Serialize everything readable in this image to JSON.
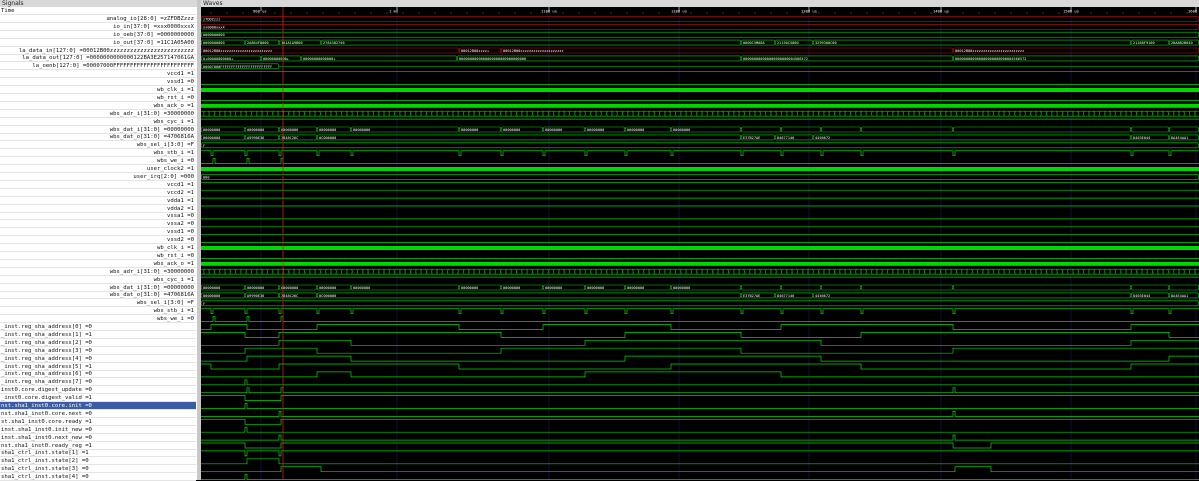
{
  "panes": {
    "signals_title": "Signals",
    "waves_title": "Waves"
  },
  "timeline": {
    "labels": [
      "900 us",
      "1 ms",
      "1100 us",
      "1200 us",
      "1300 us",
      "1400 us",
      "1500 us",
      "1600 us"
    ],
    "cursor_label": "1 ms"
  },
  "signals": [
    {
      "label": "Time",
      "align": "left"
    },
    {
      "label": "analog_io[28:0] =zZFDBZzzz",
      "align": "right"
    },
    {
      "label": "io_in[37:0] =xxx0000xxxX",
      "align": "right"
    },
    {
      "label": "io_oeb[37:0] =0000000000",
      "align": "right"
    },
    {
      "label": "io_out[37:0] =11C1A05A00",
      "align": "right"
    },
    {
      "label": "la_data_in[127:0] =00012B00zzzzzzzzzzzzzzzzzzzzzzzzz",
      "align": "right"
    },
    {
      "label": "la_data_out[127:0] =0000000000000122BA3E257147061GA",
      "align": "right"
    },
    {
      "label": "la_oenb[127:0] =00007000FFFFFFFFFFFFFFFFFFFFFFFF",
      "align": "right"
    },
    {
      "label": "vccd1 =1",
      "align": "right"
    },
    {
      "label": "vssd1 =0",
      "align": "right"
    },
    {
      "label": "wb_clk_i =1",
      "align": "right"
    },
    {
      "label": "wb_rst_i =0",
      "align": "right"
    },
    {
      "label": "wbs_ack_o =1",
      "align": "right"
    },
    {
      "label": "wbs_adr_i[31:0] =30000000",
      "align": "right"
    },
    {
      "label": "wbs_cyc_i =1",
      "align": "right"
    },
    {
      "label": "wbs_dat_i[31:0] =00000000",
      "align": "right"
    },
    {
      "label": "wbs_dat_o[31:0] =4706816A",
      "align": "right"
    },
    {
      "label": "wbs_sel_i[3:0] =F",
      "align": "right"
    },
    {
      "label": "wbs_stb_i =1",
      "align": "right"
    },
    {
      "label": "wbs_we_i =0",
      "align": "right"
    },
    {
      "label": "user_clock2 =1",
      "align": "right"
    },
    {
      "label": "user_irq[2:0] =000",
      "align": "right"
    },
    {
      "label": "vccd1 =1",
      "align": "right"
    },
    {
      "label": "vccd2 =1",
      "align": "right"
    },
    {
      "label": "vdda1 =1",
      "align": "right"
    },
    {
      "label": "vdda2 =1",
      "align": "right"
    },
    {
      "label": "vssa1 =0",
      "align": "right"
    },
    {
      "label": "vssa2 =0",
      "align": "right"
    },
    {
      "label": "vssd1 =0",
      "align": "right"
    },
    {
      "label": "vssd2 =0",
      "align": "right"
    },
    {
      "label": "wb_clk_i =1",
      "align": "right"
    },
    {
      "label": "wb_rst_i =0",
      "align": "right"
    },
    {
      "label": "wbs_ack_o =1",
      "align": "right"
    },
    {
      "label": "wbs_adr_i[31:0] =30000000",
      "align": "right"
    },
    {
      "label": "wbs_cyc_i =1",
      "align": "right"
    },
    {
      "label": "wbs_dat_i[31:0] =00000000",
      "align": "right"
    },
    {
      "label": "wbs_dat_o[31:0] =4706816A",
      "align": "right"
    },
    {
      "label": "wbs_sel_i[3:0] =F",
      "align": "right"
    },
    {
      "label": "wbs_stb_i =1",
      "align": "right"
    },
    {
      "label": "wbs_we_i =0",
      "align": "right"
    },
    {
      "label": "_inst.reg_sha_address[0] =0",
      "align": "left"
    },
    {
      "label": "_inst.reg_sha_address[1] =1",
      "align": "left"
    },
    {
      "label": "_inst.reg_sha_address[2] =0",
      "align": "left"
    },
    {
      "label": "_inst.reg_sha_address[3] =0",
      "align": "left"
    },
    {
      "label": "_inst.reg_sha_address[4] =0",
      "align": "left"
    },
    {
      "label": "_inst.reg_sha_address[5] =1",
      "align": "left"
    },
    {
      "label": "_inst.reg_sha_address[6] =0",
      "align": "left"
    },
    {
      "label": "_inst.reg_sha_address[7] =0",
      "align": "left"
    },
    {
      "label": "inst0.core.digest_update =0",
      "align": "left"
    },
    {
      "label": "_inst0.core.digest_valid =1",
      "align": "left"
    },
    {
      "label": "nst.sha1_inst0.core.init =0",
      "align": "left",
      "selected": true
    },
    {
      "label": "nst.sha1_inst0.core.next =0",
      "align": "left"
    },
    {
      "label": "st.sha1_inst0.core.ready =1",
      "align": "left"
    },
    {
      "label": "inst.sha1_inst0.init_new =0",
      "align": "left"
    },
    {
      "label": "inst.sha1_inst0.next_new =0",
      "align": "left"
    },
    {
      "label": "nst.sha1_inst0.ready_reg =1",
      "align": "left"
    },
    {
      "label": "sha1_ctrl_inst.state[1] =1",
      "align": "left"
    },
    {
      "label": "sha1_ctrl_inst.state[2] =0",
      "align": "left"
    },
    {
      "label": "sha1_ctrl_inst.state[3] =0",
      "align": "left"
    },
    {
      "label": "sha1_ctrl_inst.state[4] =0",
      "align": "left"
    }
  ],
  "bus_values": {
    "analog_io": [
      "z7DDZzzz"
    ],
    "io_in": [
      "xx0000xxxX"
    ],
    "io_oeb": [
      "0000000000"
    ],
    "io_out": [
      "0000000000",
      "2A864F8000",
      "1A1A1A9B00",
      "2784382746",
      "0000C5M00A",
      "21150C5000",
      "3299300C00",
      "21268F9100",
      "2BA8B2B040",
      "11C1A05C40"
    ],
    "la_data_in": [
      "00012B00zzzzzzzzzzzzzzzzzzzzzzzz",
      "00012B00zzzz+",
      "00012B00zzzzzzzzzzzzzzzzzzzz",
      "00012B00zzzzzzzzzzzzzzzzzzzzzzzz"
    ],
    "la_data_out": [
      "0+00000000000+",
      "00000000000+",
      "00000000000000+",
      "0000000000000000000000000000000",
      "000000000000000000000004566572",
      "000000000000000000000000004566572"
    ],
    "la_oenb": [
      "00007000FFFFFFFFFFFFFFFFFFFFFFFF"
    ],
    "wbs_dat_i": [
      "00000000",
      "00000000",
      "00000000",
      "00000000",
      "00000000",
      "00000000",
      "00000000",
      "00000000",
      "00000000",
      "00000000",
      "00000000"
    ],
    "wbs_dat_o": [
      "00000000",
      "A9990E36",
      "7848C26C",
      "0C000000",
      "E37B27AE",
      "84677140",
      "4456672",
      "8403E044",
      "8A4E4AA1",
      "E54B70F1"
    ],
    "wbs_sel_i": [
      "F"
    ],
    "user_irq": [
      "000"
    ]
  },
  "colors": {
    "wave_green": "#00d800",
    "bus_fill_green": "#00b000",
    "cursor_red": "#d02020",
    "selected_row": "#3b5ba5",
    "grid": "#1a1a5a",
    "undefined_red": "#c01010"
  }
}
